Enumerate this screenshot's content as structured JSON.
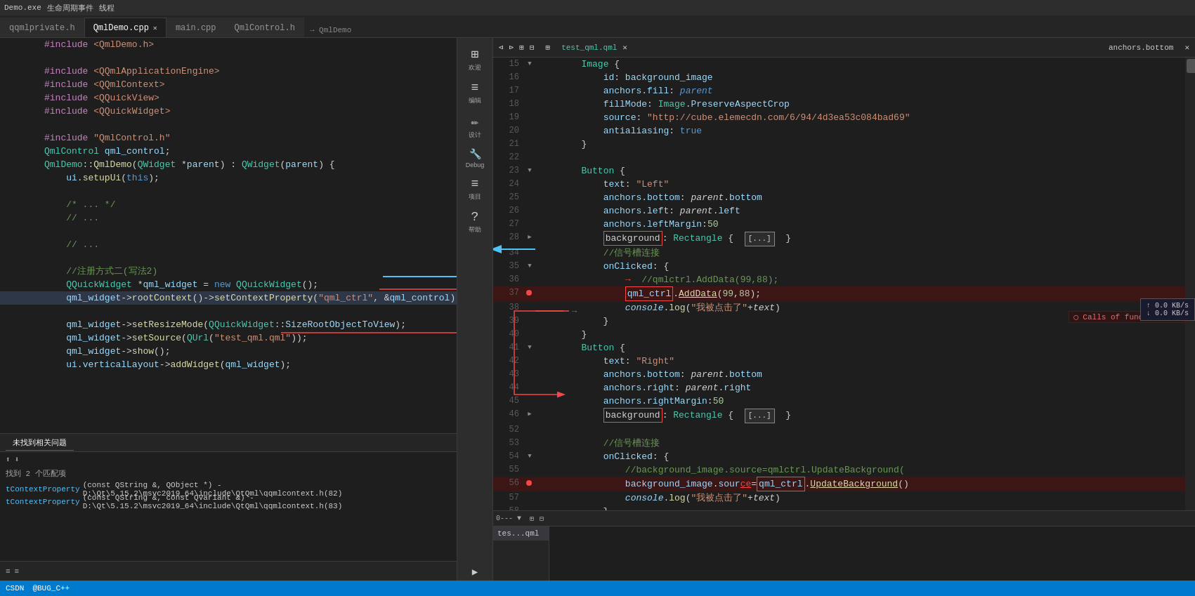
{
  "topbar": {
    "title": "Demo.exe",
    "menus": [
      "生命周期事件",
      "线程"
    ]
  },
  "tabs": [
    {
      "label": "qqmlprivate.h",
      "active": false,
      "modified": false
    },
    {
      "label": "QmlDemo.cpp",
      "active": true,
      "modified": true
    },
    {
      "label": "main.cpp",
      "active": false,
      "modified": false
    },
    {
      "label": "QmlControl.h",
      "active": false,
      "modified": false
    }
  ],
  "breadcrumb": "→  QmlDemo",
  "leftCode": {
    "lines": [
      {
        "num": "",
        "content": "#include  QmlDemo.h",
        "type": "pp"
      },
      {
        "num": "",
        "content": "",
        "type": "empty"
      },
      {
        "num": "",
        "content": "#include <QQmlApplicationEngine>",
        "type": "pp"
      },
      {
        "num": "",
        "content": "#include <QQmlContext>",
        "type": "pp"
      },
      {
        "num": "",
        "content": "#include <QQuickView>",
        "type": "pp"
      },
      {
        "num": "",
        "content": "#include <QQuickWidget>",
        "type": "pp"
      },
      {
        "num": "",
        "content": "",
        "type": "empty"
      },
      {
        "num": "",
        "content": "#include \"QmlControl.h\"",
        "type": "pp"
      },
      {
        "num": "",
        "content": "QmlControl qml_control;",
        "type": "normal"
      },
      {
        "num": "",
        "content": "QmlDemo::QmlDemo(QWidget *parent) : QWidget(parent) {",
        "type": "normal"
      },
      {
        "num": "",
        "content": "    ui.setupUi(this);",
        "type": "normal"
      },
      {
        "num": "",
        "content": "",
        "type": "empty"
      },
      {
        "num": "",
        "content": "    /* ... */",
        "type": "comment"
      },
      {
        "num": "",
        "content": "    // ...",
        "type": "comment"
      },
      {
        "num": "",
        "content": "",
        "type": "empty"
      },
      {
        "num": "",
        "content": "    // ...",
        "type": "comment"
      },
      {
        "num": "",
        "content": "",
        "type": "empty"
      },
      {
        "num": "",
        "content": "    //注册方式二(写法2)",
        "type": "comment"
      },
      {
        "num": "",
        "content": "    QQuickWidget *qml_widget = new QQuickWidget();",
        "type": "normal"
      },
      {
        "num": "",
        "content": "    qml_widget->rootContext()->setContextProperty(\"qml_ctrl\", &qml_control);",
        "type": "normal"
      },
      {
        "num": "",
        "content": "",
        "type": "empty"
      },
      {
        "num": "",
        "content": "    qml_widget->setResizeMode(QQuickWidget::SizeRootObjectToView);",
        "type": "normal"
      },
      {
        "num": "",
        "content": "    qml_widget->setSource(QUrl(\"test_qml.qml\"));",
        "type": "normal"
      },
      {
        "num": "",
        "content": "    qml_widget->show();",
        "type": "normal"
      },
      {
        "num": "",
        "content": "    ui.verticalLayout->addWidget(qml_widget);",
        "type": "normal"
      }
    ]
  },
  "rightCode": {
    "filename": "test_qml.qml",
    "lines": [
      {
        "num": 15,
        "arrow": "▼",
        "indent": 2,
        "content": "Image {",
        "type": "qml-type"
      },
      {
        "num": 16,
        "arrow": "",
        "indent": 4,
        "content": "id: background_image",
        "type": "qml-prop"
      },
      {
        "num": 17,
        "arrow": "",
        "indent": 4,
        "content": "anchors.fill: parent",
        "type": "qml-prop"
      },
      {
        "num": 18,
        "arrow": "",
        "indent": 4,
        "content": "fillMode: Image.PreserveAspectCrop",
        "type": "qml-prop"
      },
      {
        "num": 19,
        "arrow": "",
        "indent": 4,
        "content": "source: \"http://cube.elemecdn.com/6/94/4d3ea53c084bad69\"",
        "type": "qml-str"
      },
      {
        "num": 20,
        "arrow": "",
        "indent": 4,
        "content": "antialiasing: true",
        "type": "qml-prop"
      },
      {
        "num": 21,
        "arrow": "",
        "indent": 2,
        "content": "}",
        "type": "normal"
      },
      {
        "num": 22,
        "arrow": "",
        "indent": 0,
        "content": "",
        "type": "empty"
      },
      {
        "num": 23,
        "arrow": "▼",
        "indent": 2,
        "content": "Button {",
        "type": "qml-type"
      },
      {
        "num": 24,
        "arrow": "",
        "indent": 4,
        "content": "text: \"Left\"",
        "type": "qml-str"
      },
      {
        "num": 25,
        "arrow": "",
        "indent": 4,
        "content": "anchors.bottom: parent.bottom",
        "type": "qml-prop"
      },
      {
        "num": 26,
        "arrow": "",
        "indent": 4,
        "content": "anchors.left: parent.left",
        "type": "qml-prop"
      },
      {
        "num": 27,
        "arrow": "",
        "indent": 4,
        "content": "anchors.leftMargin:50",
        "type": "qml-prop"
      },
      {
        "num": 28,
        "arrow": "▶",
        "indent": 4,
        "content": "background: Rectangle {  [...]  }",
        "type": "collapsed",
        "highlight": "background"
      },
      {
        "num": 34,
        "arrow": "",
        "indent": 4,
        "content": "//信号槽连接",
        "type": "qml-cm"
      },
      {
        "num": 35,
        "arrow": "▼",
        "indent": 4,
        "content": "onClicked: {",
        "type": "qml-prop"
      },
      {
        "num": 36,
        "arrow": "",
        "indent": 6,
        "content": "→  //qmlctrl.AddData(99,88);",
        "type": "arrow-comment"
      },
      {
        "num": 37,
        "arrow": "",
        "indent": 6,
        "content": "qml_ctrl.AddData(99,88);",
        "type": "error-line",
        "error_dot": true
      },
      {
        "num": 38,
        "arrow": "",
        "indent": 6,
        "content": "console.log(\"我被点击了\"+text)",
        "type": "qml-fn"
      },
      {
        "num": 39,
        "arrow": "",
        "indent": 4,
        "content": "}",
        "type": "normal"
      },
      {
        "num": 40,
        "arrow": "",
        "indent": 2,
        "content": "}",
        "type": "normal"
      },
      {
        "num": 41,
        "arrow": "▼",
        "indent": 2,
        "content": "Button {",
        "type": "qml-type"
      },
      {
        "num": 42,
        "arrow": "",
        "indent": 4,
        "content": "text: \"Right\"",
        "type": "qml-str"
      },
      {
        "num": 43,
        "arrow": "",
        "indent": 4,
        "content": "anchors.bottom: parent.bottom",
        "type": "qml-prop"
      },
      {
        "num": 44,
        "arrow": "",
        "indent": 4,
        "content": "anchors.right: parent.right",
        "type": "qml-prop"
      },
      {
        "num": 45,
        "arrow": "",
        "indent": 4,
        "content": "anchors.rightMargin:50",
        "type": "qml-prop"
      },
      {
        "num": 46,
        "arrow": "▶",
        "indent": 4,
        "content": "background: Rectangle {  [...]  }",
        "type": "collapsed",
        "highlight": "background"
      },
      {
        "num": 52,
        "arrow": "",
        "indent": 0,
        "content": "",
        "type": "empty"
      },
      {
        "num": 53,
        "arrow": "",
        "indent": 4,
        "content": "//信号槽连接",
        "type": "qml-cm"
      },
      {
        "num": 54,
        "arrow": "▼",
        "indent": 4,
        "content": "onClicked: {",
        "type": "qml-prop"
      },
      {
        "num": 55,
        "arrow": "",
        "indent": 6,
        "content": "//background_image.source=qmlctrl.UpdateBackground(",
        "type": "qml-cm"
      },
      {
        "num": 56,
        "arrow": "",
        "indent": 6,
        "content": "background_image.source=qml_ctrl.UpdateBackground()",
        "type": "error-line2",
        "error_dot": true
      },
      {
        "num": 57,
        "arrow": "",
        "indent": 6,
        "content": "console.log(\"我被点击了\"+text)",
        "type": "qml-fn"
      },
      {
        "num": 58,
        "arrow": "",
        "indent": 4,
        "content": "}",
        "type": "normal"
      }
    ]
  },
  "bottomPanel": {
    "searchStatus": "未找到相关问题",
    "matchCount": "找到 2 个匹配项",
    "results": [
      {
        "text": "tContextProperty(const QString &, QObject *) - D:\\Qt\\5.15.2\\msvc2019_64\\include\\QtQml\\qqmlcontext.h(82)"
      },
      {
        "text": "tContextProperty(const QString &, const QVariant &) - D:\\Qt\\5.15.2\\msvc2019_64\\include\\QtQml\\qqmlcontext.h(83)"
      }
    ]
  },
  "sidebarIcons": [
    {
      "icon": "⊞",
      "label": "欢迎"
    },
    {
      "icon": "≡",
      "label": "编辑"
    },
    {
      "icon": "✏",
      "label": "设计"
    },
    {
      "icon": "🔧",
      "label": "Debug"
    },
    {
      "icon": "≡",
      "label": "项目"
    },
    {
      "icon": "?",
      "label": "帮助"
    }
  ],
  "netStats": {
    "up": "↑ 0.0 KB/s",
    "down": "↓ 0.0 KB/s"
  },
  "rightBottomTab": "tes...qml",
  "anchorsBottom": {
    "title": "anchors.bottom"
  }
}
